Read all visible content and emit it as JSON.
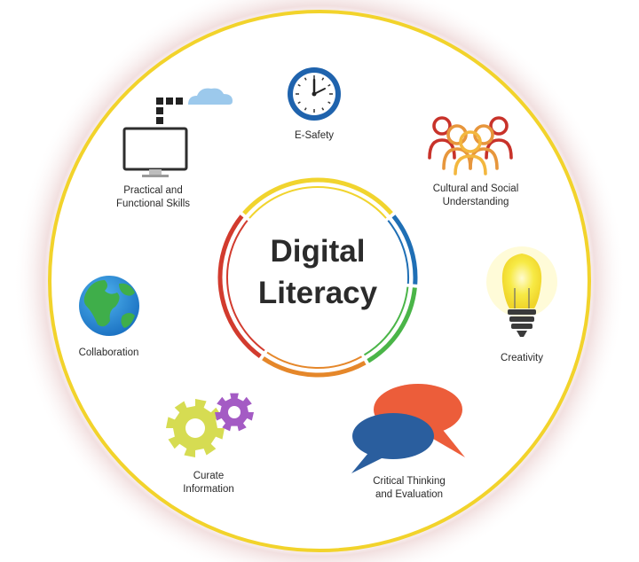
{
  "center": {
    "line1": "Digital",
    "line2": "Literacy"
  },
  "items": [
    {
      "id": "e-safety",
      "lines": [
        "E-Safety"
      ],
      "icon": "clock-icon"
    },
    {
      "id": "cultural",
      "lines": [
        "Cultural and Social",
        "Understanding"
      ],
      "icon": "people-group-icon"
    },
    {
      "id": "creativity",
      "lines": [
        "Creativity"
      ],
      "icon": "lightbulb-icon"
    },
    {
      "id": "critical",
      "lines": [
        "Critical Thinking",
        "and Evaluation"
      ],
      "icon": "speech-bubbles-icon"
    },
    {
      "id": "curate",
      "lines": [
        "Curate",
        "Information"
      ],
      "icon": "gears-icon"
    },
    {
      "id": "collaboration",
      "lines": [
        "Collaboration"
      ],
      "icon": "globe-icon"
    },
    {
      "id": "practical",
      "lines": [
        "Practical and",
        "Functional Skills"
      ],
      "icon": "monitor-cloud-icon"
    }
  ],
  "colors": {
    "outer_border": "#f2d32b",
    "ring": [
      "#f1d42e",
      "#1f6fb5",
      "#4ab548",
      "#e5872a",
      "#d23b2e"
    ]
  }
}
